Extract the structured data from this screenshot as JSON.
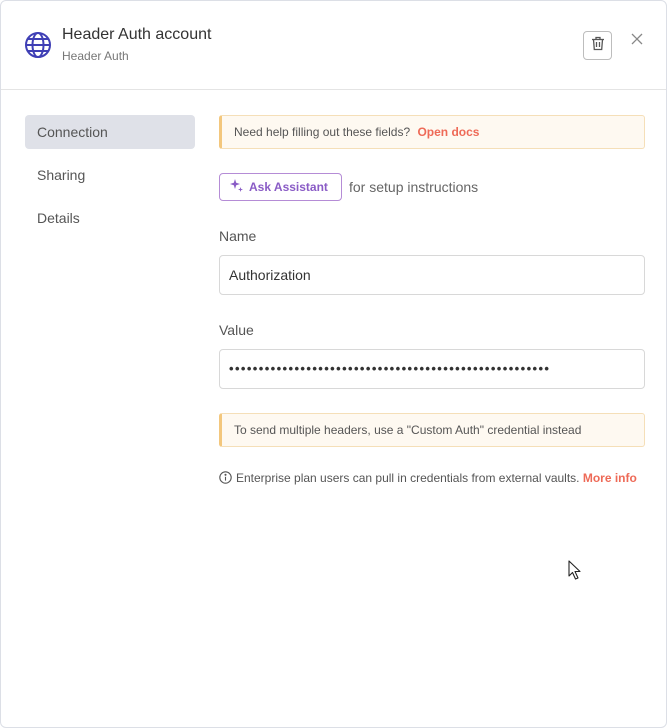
{
  "header": {
    "title": "Header Auth account",
    "subtitle": "Header Auth",
    "icon": "globe-icon",
    "accent_color": "#3f3fb5"
  },
  "sidebar": {
    "items": [
      {
        "label": "Connection",
        "active": true
      },
      {
        "label": "Sharing",
        "active": false
      },
      {
        "label": "Details",
        "active": false
      }
    ]
  },
  "main": {
    "help_callout": {
      "text": "Need help filling out these fields?",
      "link": "Open docs"
    },
    "assistant": {
      "button_label": "Ask Assistant",
      "suffix": "for setup instructions"
    },
    "name_field": {
      "label": "Name",
      "value": "Authorization"
    },
    "value_field": {
      "label": "Value",
      "value": "••••••••••••••••••••••••••••••••••••••••••••••••••••••"
    },
    "headers_callout": {
      "text": "To send multiple headers, use a \"Custom Auth\" credential instead"
    },
    "vault_info": {
      "text": "Enterprise plan users can pull in credentials from external vaults.",
      "link": "More info"
    }
  },
  "colors": {
    "link": "#ee6a57",
    "assistant": "#8a5cc6",
    "callout_border": "#f3c77d",
    "nav_active_bg": "#dfe1e8"
  }
}
